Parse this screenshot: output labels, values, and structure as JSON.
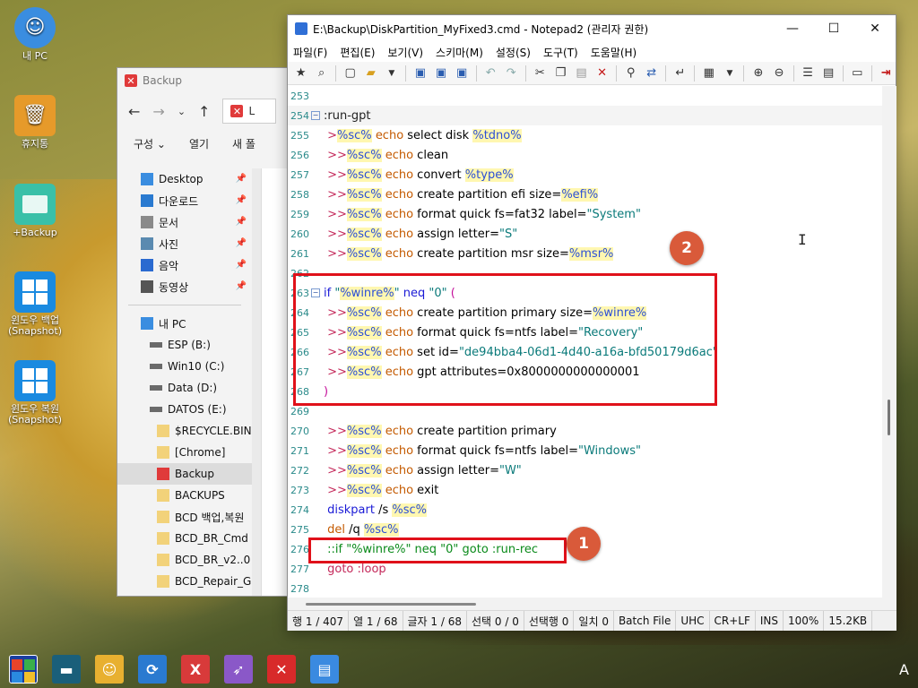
{
  "desktop": {
    "icons": [
      {
        "label": "내 PC",
        "icon": "my-pc-icon",
        "color": "#3a8de0"
      },
      {
        "label": "휴지통",
        "icon": "recycle-bin-icon",
        "color": "#e69a2a"
      },
      {
        "label": "+Backup",
        "icon": "folder-icon",
        "color": "#3ac0a8"
      },
      {
        "label": "윈도우 백업\n(Snapshot)",
        "icon": "windows-icon",
        "color": "#1a8ae0"
      },
      {
        "label": "윈도우 복원\n(Snapshot)",
        "icon": "windows-icon",
        "color": "#1a8ae0"
      }
    ]
  },
  "explorer": {
    "title": "Backup",
    "address": "L",
    "toolbar": {
      "organize": "구성 ⌄",
      "open": "열기",
      "new": "새 폴"
    },
    "quick_access": [
      {
        "label": "Desktop",
        "icon": "desktop-icon",
        "pinned": true
      },
      {
        "label": "다운로드",
        "icon": "download-icon",
        "pinned": true
      },
      {
        "label": "문서",
        "icon": "document-icon",
        "pinned": true
      },
      {
        "label": "사진",
        "icon": "picture-icon",
        "pinned": true
      },
      {
        "label": "음악",
        "icon": "music-icon",
        "pinned": true
      },
      {
        "label": "동영상",
        "icon": "video-icon",
        "pinned": true
      }
    ],
    "this_pc": {
      "label": "내 PC"
    },
    "drives": [
      {
        "label": "ESP (B:)",
        "icon": "drive-icon"
      },
      {
        "label": "Win10 (C:)",
        "icon": "drive-icon"
      },
      {
        "label": "Data (D:)",
        "icon": "drive-icon"
      },
      {
        "label": "DATOS (E:)",
        "icon": "drive-icon"
      }
    ],
    "folders": [
      {
        "label": "$RECYCLE.BIN",
        "icon": "folder-icon",
        "selected": false
      },
      {
        "label": "[Chrome]",
        "icon": "folder-icon",
        "selected": false
      },
      {
        "label": "Backup",
        "icon": "x-folder-icon",
        "selected": true
      },
      {
        "label": "BACKUPS",
        "icon": "folder-icon",
        "selected": false
      },
      {
        "label": "BCD 백업,복원",
        "icon": "folder-icon",
        "selected": false
      },
      {
        "label": "BCD_BR_Cmd",
        "icon": "folder-icon",
        "selected": false
      },
      {
        "label": "BCD_BR_v2..0",
        "icon": "folder-icon",
        "selected": false
      },
      {
        "label": "BCD_Repair_G",
        "icon": "folder-icon",
        "selected": false
      }
    ]
  },
  "notepad": {
    "title": "E:\\Backup\\DiskPartition_MyFixed3.cmd - Notepad2 (관리자 권한)",
    "menu": [
      "파일(F)",
      "편집(E)",
      "보기(V)",
      "스키마(M)",
      "설정(S)",
      "도구(T)",
      "도움말(H)"
    ],
    "lines": [
      {
        "n": "253",
        "parts": []
      },
      {
        "n": "254",
        "fold": true,
        "current": true,
        "parts": [
          {
            "t": ":run-gpt",
            "c": "c-label"
          }
        ]
      },
      {
        "n": "255",
        "parts": [
          {
            "t": " >",
            "c": "c-op"
          },
          {
            "t": "%sc%",
            "c": "c-var"
          },
          {
            "t": " ",
            "c": "txt"
          },
          {
            "t": "echo",
            "c": "c-kw"
          },
          {
            "t": " select disk ",
            "c": "txt"
          },
          {
            "t": "%tdno%",
            "c": "c-var"
          }
        ]
      },
      {
        "n": "256",
        "parts": [
          {
            "t": " >>",
            "c": "c-op"
          },
          {
            "t": "%sc%",
            "c": "c-var"
          },
          {
            "t": " ",
            "c": "txt"
          },
          {
            "t": "echo",
            "c": "c-kw"
          },
          {
            "t": " clean",
            "c": "txt"
          }
        ]
      },
      {
        "n": "257",
        "parts": [
          {
            "t": " >>",
            "c": "c-op"
          },
          {
            "t": "%sc%",
            "c": "c-var"
          },
          {
            "t": " ",
            "c": "txt"
          },
          {
            "t": "echo",
            "c": "c-kw"
          },
          {
            "t": " convert ",
            "c": "txt"
          },
          {
            "t": "%type%",
            "c": "c-var"
          }
        ]
      },
      {
        "n": "258",
        "parts": [
          {
            "t": " >>",
            "c": "c-op"
          },
          {
            "t": "%sc%",
            "c": "c-var"
          },
          {
            "t": " ",
            "c": "txt"
          },
          {
            "t": "echo",
            "c": "c-kw"
          },
          {
            "t": " create partition efi size=",
            "c": "txt"
          },
          {
            "t": "%efi%",
            "c": "c-var"
          }
        ]
      },
      {
        "n": "259",
        "parts": [
          {
            "t": " >>",
            "c": "c-op"
          },
          {
            "t": "%sc%",
            "c": "c-var"
          },
          {
            "t": " ",
            "c": "txt"
          },
          {
            "t": "echo",
            "c": "c-kw"
          },
          {
            "t": " format quick fs=fat32 label=",
            "c": "txt"
          },
          {
            "t": "\"System\"",
            "c": "c-str"
          }
        ]
      },
      {
        "n": "260",
        "parts": [
          {
            "t": " >>",
            "c": "c-op"
          },
          {
            "t": "%sc%",
            "c": "c-var"
          },
          {
            "t": " ",
            "c": "txt"
          },
          {
            "t": "echo",
            "c": "c-kw"
          },
          {
            "t": " assign letter=",
            "c": "txt"
          },
          {
            "t": "\"S\"",
            "c": "c-str"
          }
        ]
      },
      {
        "n": "261",
        "parts": [
          {
            "t": " >>",
            "c": "c-op"
          },
          {
            "t": "%sc%",
            "c": "c-var"
          },
          {
            "t": " ",
            "c": "txt"
          },
          {
            "t": "echo",
            "c": "c-kw"
          },
          {
            "t": " create partition msr size=",
            "c": "txt"
          },
          {
            "t": "%msr%",
            "c": "c-var"
          }
        ]
      },
      {
        "n": "262",
        "parts": []
      },
      {
        "n": "263",
        "fold": true,
        "parts": [
          {
            "t": "if",
            "c": "c-kwb"
          },
          {
            "t": " ",
            "c": "txt"
          },
          {
            "t": "\"",
            "c": "c-str"
          },
          {
            "t": "%winre%",
            "c": "c-var"
          },
          {
            "t": "\"",
            "c": "c-str"
          },
          {
            "t": " ",
            "c": "txt"
          },
          {
            "t": "neq",
            "c": "c-kwb"
          },
          {
            "t": " ",
            "c": "txt"
          },
          {
            "t": "\"0\"",
            "c": "c-str"
          },
          {
            "t": " (",
            "c": "c-paren"
          }
        ]
      },
      {
        "n": "264",
        "parts": [
          {
            "t": " >>",
            "c": "c-op"
          },
          {
            "t": "%sc%",
            "c": "c-var"
          },
          {
            "t": " ",
            "c": "txt"
          },
          {
            "t": "echo",
            "c": "c-kw"
          },
          {
            "t": " create partition primary size=",
            "c": "txt"
          },
          {
            "t": "%winre%",
            "c": "c-var"
          }
        ]
      },
      {
        "n": "265",
        "parts": [
          {
            "t": " >>",
            "c": "c-op"
          },
          {
            "t": "%sc%",
            "c": "c-var"
          },
          {
            "t": " ",
            "c": "txt"
          },
          {
            "t": "echo",
            "c": "c-kw"
          },
          {
            "t": " format quick fs=ntfs label=",
            "c": "txt"
          },
          {
            "t": "\"Recovery\"",
            "c": "c-str"
          }
        ]
      },
      {
        "n": "266",
        "parts": [
          {
            "t": " >>",
            "c": "c-op"
          },
          {
            "t": "%sc%",
            "c": "c-var"
          },
          {
            "t": " ",
            "c": "txt"
          },
          {
            "t": "echo",
            "c": "c-kw"
          },
          {
            "t": " set id=",
            "c": "txt"
          },
          {
            "t": "\"de94bba4-06d1-4d40-a16a-bfd50179d6ac\"",
            "c": "c-str"
          }
        ]
      },
      {
        "n": "267",
        "parts": [
          {
            "t": " >>",
            "c": "c-op"
          },
          {
            "t": "%sc%",
            "c": "c-var"
          },
          {
            "t": " ",
            "c": "txt"
          },
          {
            "t": "echo",
            "c": "c-kw"
          },
          {
            "t": " gpt attributes=0x8000000000000001",
            "c": "txt"
          }
        ]
      },
      {
        "n": "268",
        "parts": [
          {
            "t": ")",
            "c": "c-paren"
          }
        ]
      },
      {
        "n": "269",
        "parts": []
      },
      {
        "n": "270",
        "parts": [
          {
            "t": " >>",
            "c": "c-op"
          },
          {
            "t": "%sc%",
            "c": "c-var"
          },
          {
            "t": " ",
            "c": "txt"
          },
          {
            "t": "echo",
            "c": "c-kw"
          },
          {
            "t": " create partition primary",
            "c": "txt"
          }
        ]
      },
      {
        "n": "271",
        "parts": [
          {
            "t": " >>",
            "c": "c-op"
          },
          {
            "t": "%sc%",
            "c": "c-var"
          },
          {
            "t": " ",
            "c": "txt"
          },
          {
            "t": "echo",
            "c": "c-kw"
          },
          {
            "t": " format quick fs=ntfs label=",
            "c": "txt"
          },
          {
            "t": "\"Windows\"",
            "c": "c-str"
          }
        ]
      },
      {
        "n": "272",
        "parts": [
          {
            "t": " >>",
            "c": "c-op"
          },
          {
            "t": "%sc%",
            "c": "c-var"
          },
          {
            "t": " ",
            "c": "txt"
          },
          {
            "t": "echo",
            "c": "c-kw"
          },
          {
            "t": " assign letter=",
            "c": "txt"
          },
          {
            "t": "\"W\"",
            "c": "c-str"
          }
        ]
      },
      {
        "n": "273",
        "parts": [
          {
            "t": " >>",
            "c": "c-op"
          },
          {
            "t": "%sc%",
            "c": "c-var"
          },
          {
            "t": " ",
            "c": "txt"
          },
          {
            "t": "echo",
            "c": "c-kw"
          },
          {
            "t": " exit",
            "c": "txt"
          }
        ]
      },
      {
        "n": "274",
        "parts": [
          {
            "t": " diskpart",
            "c": "c-kwb"
          },
          {
            "t": " /s ",
            "c": "txt"
          },
          {
            "t": "%sc%",
            "c": "c-var"
          }
        ]
      },
      {
        "n": "275",
        "parts": [
          {
            "t": " del",
            "c": "c-kw"
          },
          {
            "t": " /q ",
            "c": "txt"
          },
          {
            "t": "%sc%",
            "c": "c-var"
          }
        ]
      },
      {
        "n": "276",
        "parts": [
          {
            "t": " ::if \"%winre%\" neq \"0\" goto :run-rec",
            "c": "c-cmt"
          }
        ]
      },
      {
        "n": "277",
        "parts": [
          {
            "t": " goto",
            "c": "c-goto"
          },
          {
            "t": " :loop",
            "c": "c-lbl2"
          }
        ]
      },
      {
        "n": "278",
        "parts": []
      }
    ],
    "status": [
      "행 1 / 407",
      "열 1 / 68",
      "글자 1 / 68",
      "선택 0 / 0",
      "선택행 0",
      "일치 0",
      "Batch File",
      "UHC",
      "CR+LF",
      "INS",
      "100%",
      "15.2KB"
    ]
  },
  "annotations": [
    {
      "number": "1"
    },
    {
      "number": "2"
    }
  ],
  "taskbar": {
    "ime": "A",
    "apps": [
      {
        "name": "start-button",
        "color": "#1b3fa0"
      },
      {
        "name": "taskbar-app-monitor",
        "color": "#1a5f7a",
        "glyph": "▬"
      },
      {
        "name": "taskbar-app-user",
        "color": "#e8b030",
        "glyph": "☺"
      },
      {
        "name": "taskbar-app-sync",
        "color": "#2a7ad0",
        "glyph": "⟳"
      },
      {
        "name": "taskbar-app-x",
        "color": "#d83a3a",
        "glyph": "X"
      },
      {
        "name": "taskbar-app-rocket",
        "color": "#8a58c8",
        "glyph": "➶"
      },
      {
        "name": "taskbar-app-xbox",
        "color": "#d82a2a",
        "glyph": "✕"
      },
      {
        "name": "taskbar-app-notepad",
        "color": "#3a8ae0",
        "glyph": "▤"
      }
    ]
  }
}
